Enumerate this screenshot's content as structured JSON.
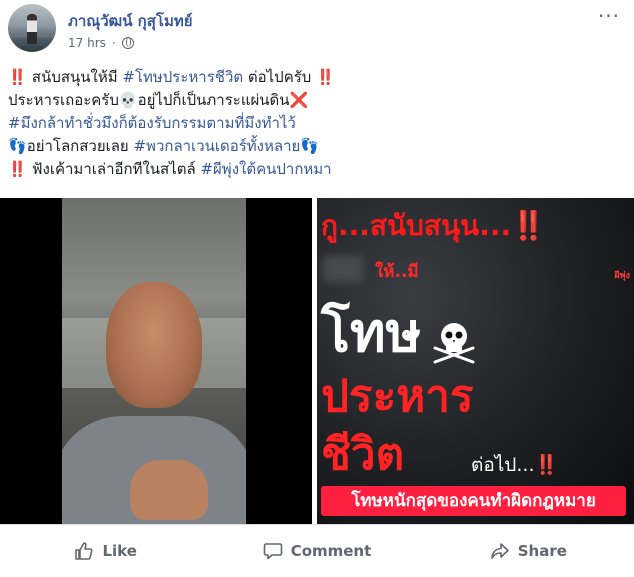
{
  "post": {
    "author": "ภาณุวัฒน์ กุสุโมทย์",
    "timestamp": "17 hrs",
    "separator": "·",
    "more_glyph": "···",
    "text_lines": [
      {
        "prefix": "‼️ ",
        "body": "สนับสนุนให้มี ",
        "tag": "#โทษประหารชีวิต",
        "suffix": " ต่อไปครับ ‼️"
      },
      {
        "prefix": "",
        "body": "ประหารเถอะครับ💀อยู่ไปก็เป็นภาระแผ่นดิน❌",
        "tag": "",
        "suffix": ""
      },
      {
        "prefix": "",
        "body": "",
        "tag": "#มึงกล้าทำชั่วมึงก็ต้องรับกรรมตามที่มึงทำไว้",
        "suffix": ""
      },
      {
        "prefix": "👣",
        "body": "อย่าโลกสวยเลย ",
        "tag": "#พวกลาเวนเดอร์ทั้งหลาย",
        "suffix": "👣"
      },
      {
        "prefix": "‼️ ",
        "body": "ฟังเค้ามาเล่าอีกทีในสไตล์ ",
        "tag": "#ผีพุ่งใต้คนปากหมา",
        "suffix": ""
      }
    ]
  },
  "media": {
    "poster": {
      "line1": "กู...สนับสนุน...",
      "line1_exc": "‼️",
      "line2": "ให้..มี",
      "corner": "ผีพุ่ง",
      "line3": "โทษ",
      "line4": "ประหาร",
      "line5": "ชีวิต",
      "line6": "ต่อไป...",
      "line6_exc": "‼️",
      "banner": "โทษหนักสุดของคนทำผิดกฎหมาย"
    }
  },
  "actions": {
    "like": "Like",
    "comment": "Comment",
    "share": "Share"
  },
  "colors": {
    "link": "#385898",
    "accent_red": "#ff1f3e",
    "muted": "#606770"
  }
}
